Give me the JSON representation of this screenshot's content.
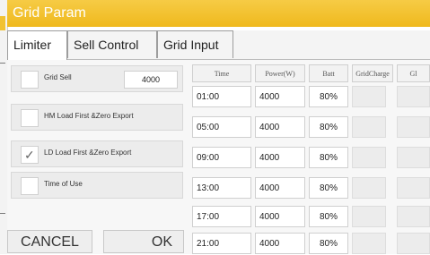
{
  "window": {
    "title": "Grid Param"
  },
  "tabs": [
    {
      "label": "Limiter",
      "active": true
    },
    {
      "label": "Sell Control",
      "active": false
    },
    {
      "label": "Grid Input",
      "active": false
    }
  ],
  "options": [
    {
      "label": "Grid Sell",
      "checked": false,
      "value": "4000"
    },
    {
      "label": "HM Load First &Zero Export",
      "checked": false
    },
    {
      "label": "LD Load First &Zero Export",
      "checked": true
    },
    {
      "label": "Time of Use",
      "checked": false
    }
  ],
  "buttons": {
    "cancel": "CANCEL",
    "ok": "OK"
  },
  "schedule": {
    "headers": [
      "Time",
      "Power(W)",
      "Batt",
      "GridCharge",
      "Gl"
    ],
    "rows": [
      {
        "time": "01:00",
        "power": "4000",
        "batt": "80%"
      },
      {
        "time": "05:00",
        "power": "4000",
        "batt": "80%"
      },
      {
        "time": "09:00",
        "power": "4000",
        "batt": "80%"
      },
      {
        "time": "13:00",
        "power": "4000",
        "batt": "80%"
      },
      {
        "time": "17:00",
        "power": "4000",
        "batt": "80%"
      },
      {
        "time": "21:00",
        "power": "4000",
        "batt": "80%"
      }
    ]
  },
  "colors": {
    "title_bar": "#efb91d",
    "title_text": "#ffffff"
  }
}
